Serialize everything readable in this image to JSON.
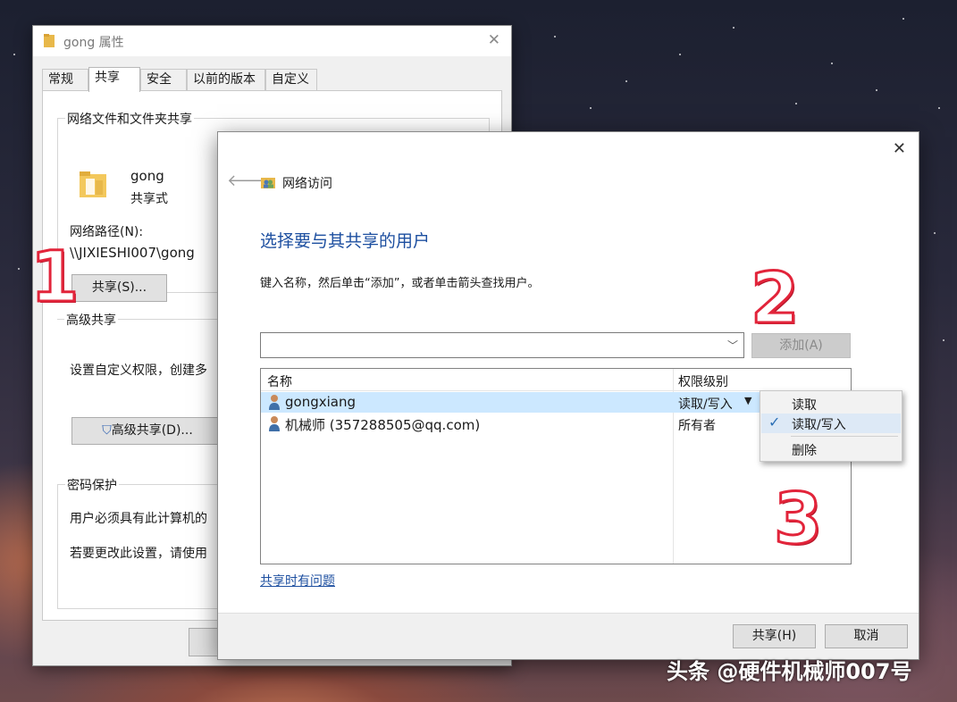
{
  "properties_window": {
    "title": "gong 属性",
    "tabs": [
      "常规",
      "共享",
      "安全",
      "以前的版本",
      "自定义"
    ],
    "network_share_group": {
      "legend": "网络文件和文件夹共享",
      "folder_name": "gong",
      "folder_status": "共享式",
      "network_path_label": "网络路径(N):",
      "network_path_value": "\\\\JIXIESHI007\\gong",
      "share_button": "共享(S)..."
    },
    "advanced_group": {
      "legend": "高级共享",
      "description": "设置自定义权限，创建多",
      "advanced_button": "高级共享(D)..."
    },
    "password_group": {
      "legend": "密码保护",
      "line1": "用户必须具有此计算机的",
      "line2": "若要更改此设置，请使用"
    }
  },
  "share_dialog": {
    "window_title": "网络访问",
    "heading": "选择要与其共享的用户",
    "instruction": "键入名称，然后单击“添加”，或者单击箭头查找用户。",
    "combo_value": "",
    "add_button": "添加(A)",
    "columns": {
      "name": "名称",
      "permission": "权限级别"
    },
    "users": [
      {
        "name": "gongxiang",
        "permission": "读取/写入",
        "selected": true
      },
      {
        "name": "机械师 (357288505@qq.com)",
        "permission": "所有者",
        "selected": false
      }
    ],
    "help_link": "共享时有问题",
    "share_button": "共享(H)",
    "cancel_button": "取消"
  },
  "permission_menu": {
    "items": [
      {
        "label": "读取",
        "checked": false
      },
      {
        "label": "读取/写入",
        "checked": true
      },
      {
        "label": "删除",
        "checked": false
      }
    ]
  },
  "annotations": {
    "step1": "1",
    "step2": "2",
    "step3": "3"
  },
  "watermark": "头条 @硬件机械师007号",
  "colors": {
    "heading_blue": "#1d4fa0",
    "selection": "#cce8ff",
    "annotation_red": "#e2243a"
  }
}
